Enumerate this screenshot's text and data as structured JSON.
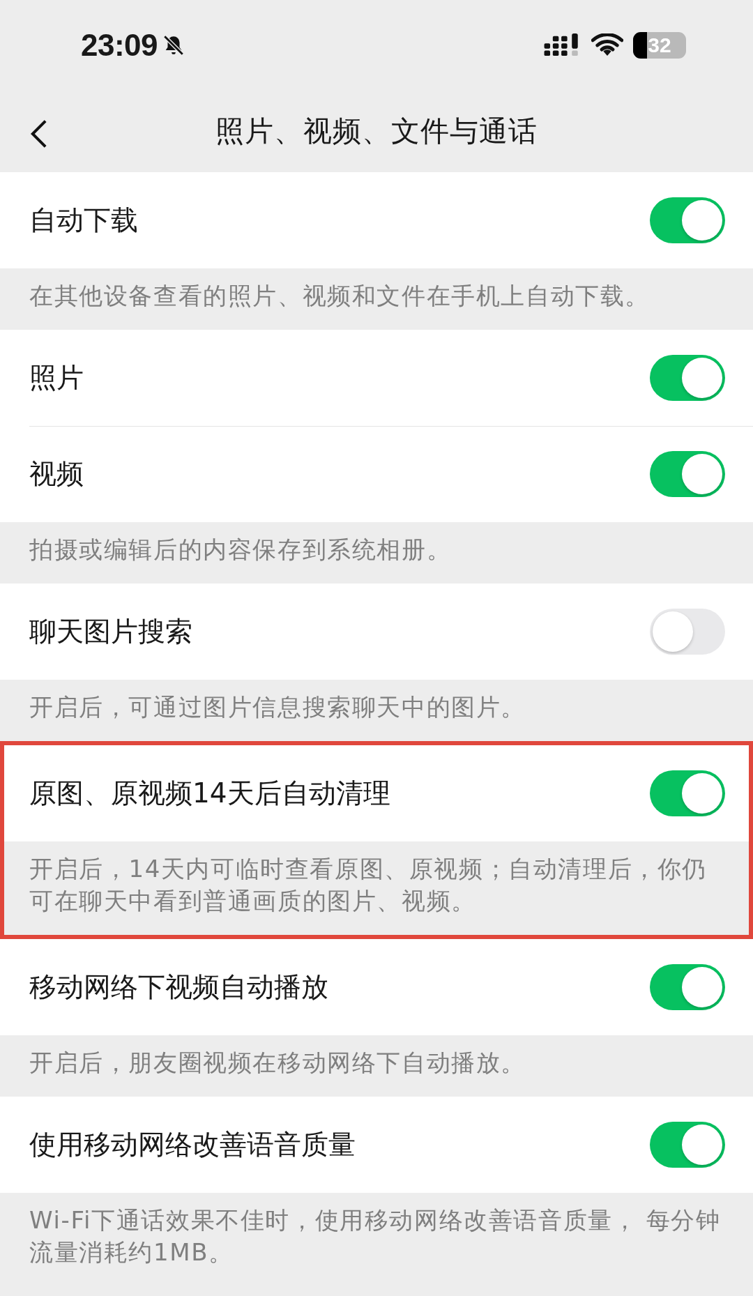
{
  "status_bar": {
    "time": "23:09",
    "battery": "32"
  },
  "nav": {
    "title": "照片、视频、文件与通话"
  },
  "groups": [
    {
      "highlighted": false,
      "rows": [
        {
          "label": "自动下载",
          "on": true
        }
      ],
      "footer": "在其他设备查看的照片、视频和文件在手机上自动下载。"
    },
    {
      "highlighted": false,
      "rows": [
        {
          "label": "照片",
          "on": true
        },
        {
          "label": "视频",
          "on": true
        }
      ],
      "footer": "拍摄或编辑后的内容保存到系统相册。"
    },
    {
      "highlighted": false,
      "rows": [
        {
          "label": "聊天图片搜索",
          "on": false
        }
      ],
      "footer": "开启后，可通过图片信息搜索聊天中的图片。"
    },
    {
      "highlighted": true,
      "rows": [
        {
          "label": "原图、原视频14天后自动清理",
          "on": true
        }
      ],
      "footer": "开启后，14天内可临时查看原图、原视频；自动清理后，你仍可在聊天中看到普通画质的图片、视频。"
    },
    {
      "highlighted": false,
      "rows": [
        {
          "label": "移动网络下视频自动播放",
          "on": true
        }
      ],
      "footer": "开启后，朋友圈视频在移动网络下自动播放。"
    },
    {
      "highlighted": false,
      "rows": [
        {
          "label": "使用移动网络改善语音质量",
          "on": true
        }
      ],
      "footer": "Wi-Fi下通话效果不佳时，使用移动网络改善语音质量， 每分钟流量消耗约1MB。"
    }
  ]
}
